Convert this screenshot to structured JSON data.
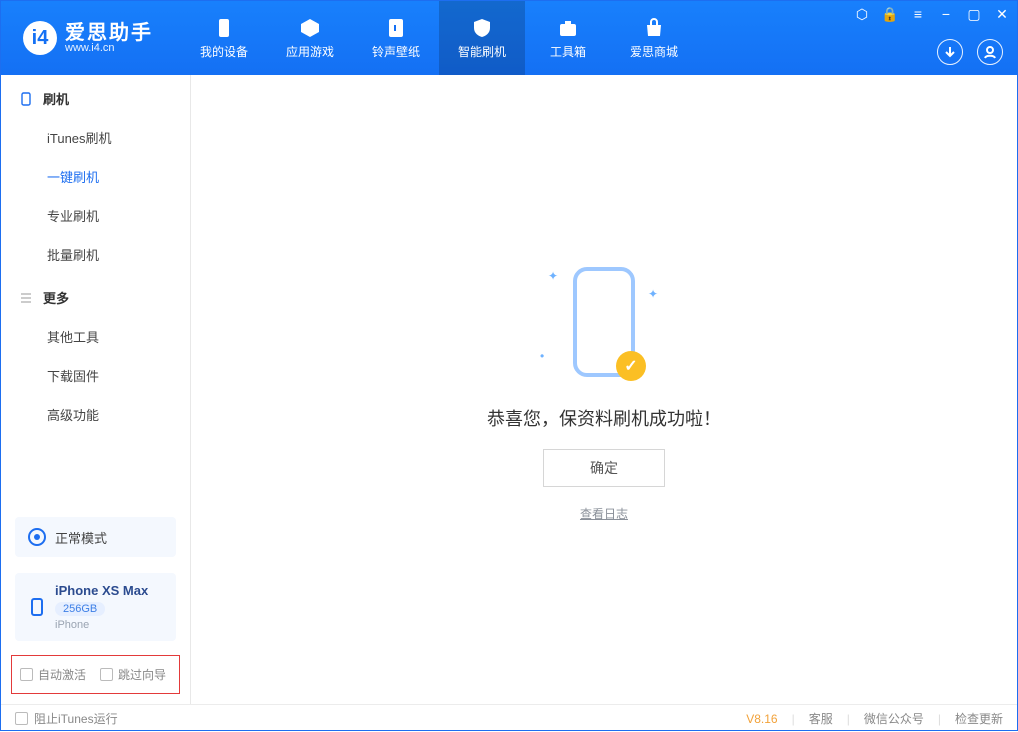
{
  "app": {
    "name_cn": "爱思助手",
    "name_en": "www.i4.cn"
  },
  "nav": [
    {
      "label": "我的设备"
    },
    {
      "label": "应用游戏"
    },
    {
      "label": "铃声壁纸"
    },
    {
      "label": "智能刷机"
    },
    {
      "label": "工具箱"
    },
    {
      "label": "爱思商城"
    }
  ],
  "sidebar": {
    "groups": [
      {
        "title": "刷机",
        "items": [
          "iTunes刷机",
          "一键刷机",
          "专业刷机",
          "批量刷机"
        ]
      },
      {
        "title": "更多",
        "items": [
          "其他工具",
          "下载固件",
          "高级功能"
        ]
      }
    ],
    "mode_card": {
      "label": "正常模式"
    },
    "device_card": {
      "name": "iPhone XS Max",
      "storage": "256GB",
      "type": "iPhone"
    },
    "opts": {
      "auto_activate": "自动激活",
      "skip_guide": "跳过向导"
    }
  },
  "main": {
    "success_msg": "恭喜您，保资料刷机成功啦！",
    "ok_btn": "确定",
    "view_log": "查看日志"
  },
  "footer": {
    "block_itunes": "阻止iTunes运行",
    "version": "V8.16",
    "links": [
      "客服",
      "微信公众号",
      "检查更新"
    ]
  }
}
